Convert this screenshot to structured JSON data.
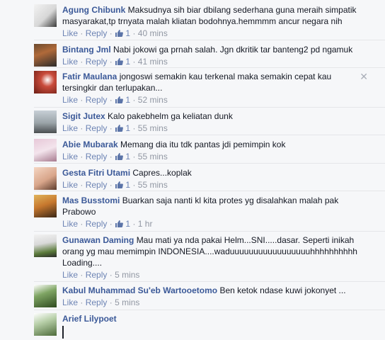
{
  "labels": {
    "like": "Like",
    "reply": "Reply",
    "sep": "·",
    "close": "✕"
  },
  "comments": [
    {
      "author": "Agung Chibunk",
      "text": "Maksudnya sih biar dbilang sederhana guna meraih simpatik masyarakat,tp trnyata malah kliatan bodohnya.hemmmm ancur negara nih",
      "likes": "1",
      "time": "40 mins"
    },
    {
      "author": "Bintang Jml",
      "text": "Nabi jokowi ga prnah salah. Jgn dkritik tar banteng2 pd ngamuk",
      "likes": "1",
      "time": "41 mins"
    },
    {
      "author": "Fatir Maulana",
      "text": "jongoswi semakin kau terkenal maka semakin cepat kau tersingkir dan terlupakan...",
      "likes": "1",
      "time": "52 mins"
    },
    {
      "author": "Sigit Jutex",
      "text": "Kalo pakebhelm ga keliatan dunk",
      "likes": "1",
      "time": "55 mins"
    },
    {
      "author": "Abie Mubarak",
      "text": "Memang dia itu tdk pantas jdi pemimpin kok",
      "likes": "1",
      "time": "55 mins"
    },
    {
      "author": "Gesta Fitri Utami",
      "text": "Capres...koplak",
      "likes": "1",
      "time": "55 mins"
    },
    {
      "author": "Mas Busstomi",
      "text": "Buarkan saja nanti kl kita protes yg disalahkan malah pak Prabowo",
      "likes": "1",
      "time": "1 hr"
    },
    {
      "author": "Gunawan Daming",
      "text": "Mau mati ya nda pakai Helm...SNI.....dasar. Seperti inikah orang yg mau memimpin INDONESIA....waduuuuuuuuuuuuuuuuuhhhhhhhhhh Loading....",
      "likes": "",
      "time": "5 mins"
    },
    {
      "author": "Kabul Muhammad Su'eb Wartooetomo",
      "text": "Ben ketok ndase kuwi jokonyet ...",
      "likes": "",
      "time": "5 mins"
    },
    {
      "author": "Arief Lilypoet",
      "text": "",
      "likes": "",
      "time": ""
    }
  ]
}
